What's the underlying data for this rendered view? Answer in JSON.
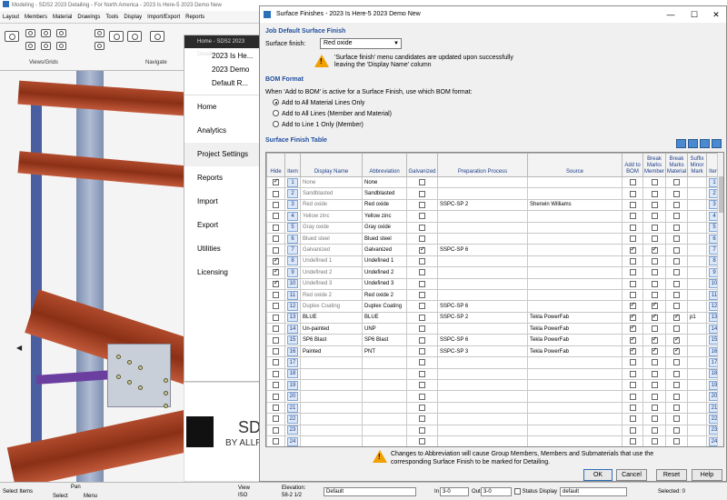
{
  "app": {
    "title": "Modeling - SDS2 2023 Detailing - For North America - 2023 Is Here-5 2023 Demo New",
    "menu": [
      "Layout",
      "Members",
      "Material",
      "Drawings",
      "Tools",
      "Display",
      "Import/Export",
      "Reports"
    ],
    "ribbon_groups": [
      "Views/Grids",
      "Navigate"
    ]
  },
  "side_panel": {
    "header": "Home - SDS2 2023 Detaili...",
    "project_items": [
      "2023 Is He...",
      "2023 Demo",
      "Default R..."
    ],
    "nav": [
      "Home",
      "Analytics",
      "Project Settings",
      "Reports",
      "Import",
      "Export",
      "Utilities",
      "Licensing"
    ],
    "active_nav": "Project Settings",
    "logo_text": "SD",
    "logo_sub": "BY ALLP"
  },
  "dialog": {
    "title": "Surface Finishes - 2023 Is Here-5 2023 Demo New",
    "window_buttons": [
      "—",
      "☐",
      "✕"
    ],
    "section_default": "Job Default Surface Finish",
    "surface_finish_label": "Surface finish:",
    "surface_finish_value": "Red oxide",
    "warning_text": "'Surface finish' menu candidates are updated upon successfully leaving the 'Display Name' column",
    "section_bom": "BOM Format",
    "bom_prompt": "When 'Add to BOM' is active for a Surface Finish, use which BOM format:",
    "bom_options": [
      "Add to All Material Lines Only",
      "Add to All Lines (Member and Material)",
      "Add to Line 1 Only (Member)"
    ],
    "bom_selected": 0,
    "section_table": "Surface Finish Table",
    "table_headers": [
      "Hide",
      "Item",
      "Display Name",
      "Abbreviation",
      "Galvanized",
      "Preparation Process",
      "Source",
      "Add to BOM",
      "Break Marks Member",
      "Break Marks Material",
      "Suffix Minor Mark",
      "Item"
    ],
    "rows": [
      {
        "n": "1",
        "hide": true,
        "name": "None",
        "abbr": "None",
        "galv": false,
        "prep": "",
        "source": "",
        "bom": false,
        "bm": false,
        "bmat": false,
        "suffix": "",
        "dim": true
      },
      {
        "n": "2",
        "hide": false,
        "name": "Sandblasted",
        "abbr": "Sandblasted",
        "galv": false,
        "prep": "",
        "source": "",
        "bom": false,
        "bm": false,
        "bmat": false,
        "suffix": "",
        "dim": true
      },
      {
        "n": "3",
        "hide": false,
        "name": "Red oxide",
        "abbr": "Red oxide",
        "galv": false,
        "prep": "SSPC-SP 2",
        "source": "Sherwin Williams",
        "bom": false,
        "bm": false,
        "bmat": false,
        "suffix": "",
        "dim": true
      },
      {
        "n": "4",
        "hide": false,
        "name": "Yellow zinc",
        "abbr": "Yellow zinc",
        "galv": false,
        "prep": "",
        "source": "",
        "bom": false,
        "bm": false,
        "bmat": false,
        "suffix": "",
        "dim": true
      },
      {
        "n": "5",
        "hide": false,
        "name": "Gray oxide",
        "abbr": "Gray oxide",
        "galv": false,
        "prep": "",
        "source": "",
        "bom": false,
        "bm": false,
        "bmat": false,
        "suffix": "",
        "dim": true
      },
      {
        "n": "6",
        "hide": false,
        "name": "Blued steel",
        "abbr": "Blued steel",
        "galv": false,
        "prep": "",
        "source": "",
        "bom": false,
        "bm": false,
        "bmat": false,
        "suffix": "",
        "dim": true
      },
      {
        "n": "7",
        "hide": false,
        "name": "Galvanized",
        "abbr": "Galvanized",
        "galv": true,
        "prep": "SSPC-SP 6",
        "source": "",
        "bom": true,
        "bm": true,
        "bmat": false,
        "suffix": "",
        "dim": true
      },
      {
        "n": "8",
        "hide": true,
        "name": "Undefined 1",
        "abbr": "Undefined 1",
        "galv": false,
        "prep": "",
        "source": "",
        "bom": false,
        "bm": false,
        "bmat": false,
        "suffix": "",
        "dim": true
      },
      {
        "n": "9",
        "hide": true,
        "name": "Undefined 2",
        "abbr": "Undefined 2",
        "galv": false,
        "prep": "",
        "source": "",
        "bom": false,
        "bm": false,
        "bmat": false,
        "suffix": "",
        "dim": true
      },
      {
        "n": "10",
        "hide": true,
        "name": "Undefined 3",
        "abbr": "Undefined 3",
        "galv": false,
        "prep": "",
        "source": "",
        "bom": false,
        "bm": false,
        "bmat": false,
        "suffix": "",
        "dim": true
      },
      {
        "n": "11",
        "hide": false,
        "name": "Red oxide 2",
        "abbr": "Red oxide 2",
        "galv": false,
        "prep": "",
        "source": "",
        "bom": false,
        "bm": false,
        "bmat": false,
        "suffix": "",
        "dim": true
      },
      {
        "n": "12",
        "hide": false,
        "name": "Duplex Coating",
        "abbr": "Duplex Coating",
        "galv": false,
        "prep": "SSPC-SP 6",
        "source": "",
        "bom": true,
        "bm": true,
        "bmat": false,
        "suffix": "",
        "dim": true
      },
      {
        "n": "13",
        "hide": false,
        "name": "BLUE",
        "abbr": "BLUE",
        "galv": false,
        "prep": "SSPC-SP 2",
        "source": "Tekla PowerFab",
        "bom": true,
        "bm": true,
        "bmat": true,
        "suffix": "p1",
        "dim": false
      },
      {
        "n": "14",
        "hide": false,
        "name": "Un-painted",
        "abbr": "UNP",
        "galv": false,
        "prep": "",
        "source": "Tekla PowerFab",
        "bom": true,
        "bm": false,
        "bmat": false,
        "suffix": "",
        "dim": false
      },
      {
        "n": "15",
        "hide": false,
        "name": "SP6 Blast",
        "abbr": "SP6 Blast",
        "galv": false,
        "prep": "SSPC-SP 6",
        "source": "Tekla PowerFab",
        "bom": true,
        "bm": true,
        "bmat": true,
        "suffix": "",
        "dim": false
      },
      {
        "n": "16",
        "hide": false,
        "name": "Painted",
        "abbr": "PNT",
        "galv": false,
        "prep": "SSPC-SP 3",
        "source": "Tekla PowerFab",
        "bom": true,
        "bm": true,
        "bmat": true,
        "suffix": "",
        "dim": false
      },
      {
        "n": "17",
        "hide": false,
        "name": "",
        "abbr": "",
        "galv": false,
        "prep": "",
        "source": "",
        "bom": false,
        "bm": false,
        "bmat": false,
        "suffix": "",
        "dim": false
      },
      {
        "n": "18",
        "hide": false,
        "name": "",
        "abbr": "",
        "galv": false,
        "prep": "",
        "source": "",
        "bom": false,
        "bm": false,
        "bmat": false,
        "suffix": "",
        "dim": false
      },
      {
        "n": "19",
        "hide": false,
        "name": "",
        "abbr": "",
        "galv": false,
        "prep": "",
        "source": "",
        "bom": false,
        "bm": false,
        "bmat": false,
        "suffix": "",
        "dim": false
      },
      {
        "n": "20",
        "hide": false,
        "name": "",
        "abbr": "",
        "galv": false,
        "prep": "",
        "source": "",
        "bom": false,
        "bm": false,
        "bmat": false,
        "suffix": "",
        "dim": false
      },
      {
        "n": "21",
        "hide": false,
        "name": "",
        "abbr": "",
        "galv": false,
        "prep": "",
        "source": "",
        "bom": false,
        "bm": false,
        "bmat": false,
        "suffix": "",
        "dim": false
      },
      {
        "n": "22",
        "hide": false,
        "name": "",
        "abbr": "",
        "galv": false,
        "prep": "",
        "source": "",
        "bom": false,
        "bm": false,
        "bmat": false,
        "suffix": "",
        "dim": false
      },
      {
        "n": "23",
        "hide": false,
        "name": "",
        "abbr": "",
        "galv": false,
        "prep": "",
        "source": "",
        "bom": false,
        "bm": false,
        "bmat": false,
        "suffix": "",
        "dim": false
      },
      {
        "n": "24",
        "hide": false,
        "name": "",
        "abbr": "",
        "galv": false,
        "prep": "",
        "source": "",
        "bom": false,
        "bm": false,
        "bmat": false,
        "suffix": "",
        "dim": false
      }
    ],
    "bottom_warning": "Changes to Abbreviation will cause Group Members, Members and Submaterials that use the corresponding Surface Finish to be marked for Detailing.",
    "buttons": [
      "OK",
      "Cancel",
      "Reset",
      "Help"
    ]
  },
  "status": {
    "select_items": "Select Items",
    "pan": "Pan",
    "select": "Select",
    "menu": "Menu",
    "view": "View",
    "iso": "ISO",
    "elevation": "Elevation:",
    "elevation_value": "58-2 1/2",
    "display_value": "Default",
    "in_label": "In",
    "in_value": "3-0",
    "out_label": "Out",
    "out_value": "3-0",
    "status_display": "Status Display",
    "status_value": "default",
    "selected": "Selected: 0"
  },
  "colors": {
    "accent": "#2c6fb8",
    "header_text": "#1f3f8a",
    "warning": "#f0a000",
    "beam": "#b04a2c"
  }
}
